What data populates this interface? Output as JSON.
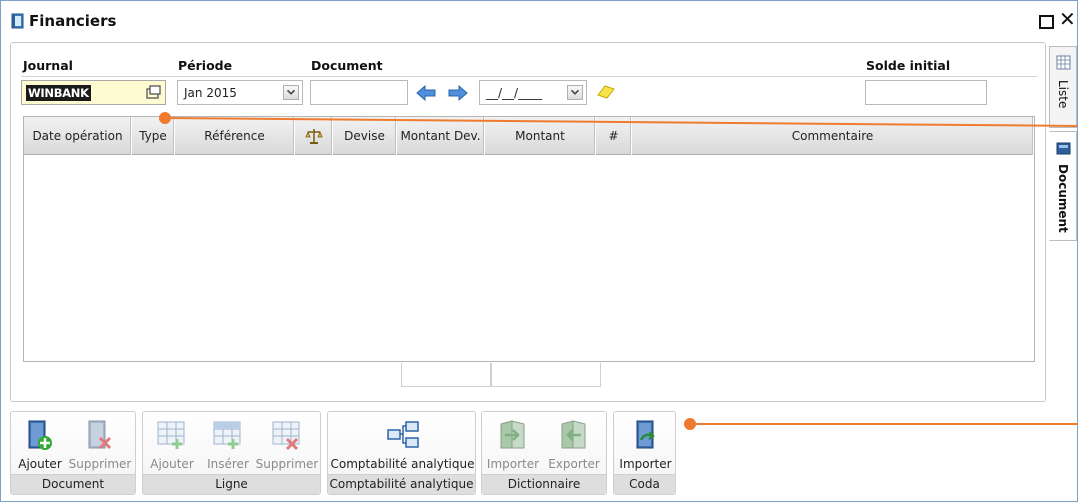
{
  "window": {
    "title": "Financiers"
  },
  "header": {
    "journal_label": "Journal",
    "journal_value": "WINBANK",
    "periode_label": "Période",
    "periode_value": "Jan 2015",
    "document_label": "Document",
    "document_value": "",
    "date_value": "__/__/____",
    "solde_label": "Solde initial",
    "solde_value": ""
  },
  "grid": {
    "columns": [
      "Date opération",
      "Type",
      "Référence",
      "",
      "Devise",
      "Montant Dev.",
      "Montant",
      "#",
      "Commentaire"
    ],
    "rows": []
  },
  "side_tabs": [
    {
      "label": "Liste",
      "active": false,
      "icon": "grid-icon"
    },
    {
      "label": "Document",
      "active": true,
      "icon": "document-icon"
    }
  ],
  "ribbon": {
    "groups": [
      {
        "caption": "Document",
        "buttons": [
          {
            "label": "Ajouter",
            "icon": "door-add-icon",
            "enabled": true
          },
          {
            "label": "Supprimer",
            "icon": "door-delete-icon",
            "enabled": false
          }
        ]
      },
      {
        "caption": "Ligne",
        "buttons": [
          {
            "label": "Ajouter",
            "icon": "row-add-icon",
            "enabled": false
          },
          {
            "label": "Insérer",
            "icon": "row-insert-icon",
            "enabled": false
          },
          {
            "label": "Supprimer",
            "icon": "row-delete-icon",
            "enabled": false
          }
        ]
      },
      {
        "caption": "Comptabilité analytique",
        "buttons": [
          {
            "label": "Comptabilité analytique",
            "icon": "hierarchy-icon",
            "enabled": true
          }
        ]
      },
      {
        "caption": "Dictionnaire",
        "buttons": [
          {
            "label": "Importer",
            "icon": "book-import-icon",
            "enabled": false
          },
          {
            "label": "Exporter",
            "icon": "book-export-icon",
            "enabled": false
          }
        ]
      },
      {
        "caption": "Coda",
        "buttons": [
          {
            "label": "Importer",
            "icon": "door-import-icon",
            "enabled": true
          }
        ]
      }
    ]
  },
  "colors": {
    "accent": "#ef7b2e",
    "journal_bg": "#fefbd3",
    "border": "#7ea0c8"
  }
}
